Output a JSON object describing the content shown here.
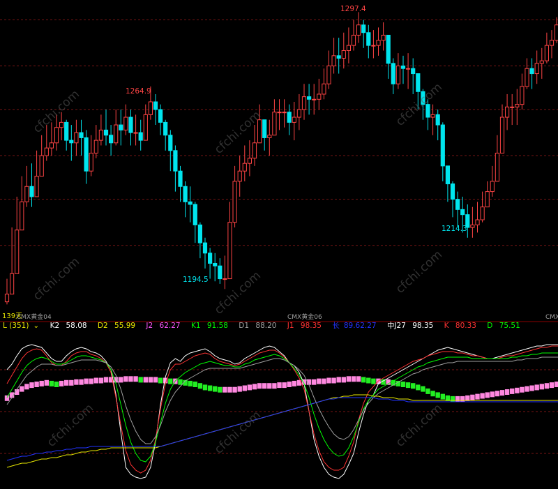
{
  "watermark": "cfchi.com",
  "colors": {
    "background": "#000000",
    "up_candle": "#ff4444",
    "down_candle": "#00e5ee",
    "grid_dash": "#7a1515",
    "frame": "#8b0000",
    "high_label": "#ff4444",
    "low_label": "#00e5ee"
  },
  "chart_data": [
    {
      "type": "candlestick",
      "title": "",
      "price_range": [
        1185,
        1302
      ],
      "annotations": {
        "peak_left": "1264.9",
        "peak_right": "1297.4",
        "trough_mid": "1194.5",
        "trough_right": "1214.3",
        "left_price_tag": "139天"
      },
      "x_labels": [
        "CMX黄金04",
        "CMX黄金06",
        "CMX"
      ],
      "close": [
        1190,
        1198,
        1215,
        1226,
        1232,
        1228,
        1236,
        1244,
        1247,
        1249,
        1255,
        1257,
        1250,
        1249,
        1253,
        1251,
        1238,
        1245,
        1250,
        1254,
        1252,
        1249,
        1256,
        1254,
        1259,
        1253,
        1253,
        1250,
        1260,
        1265,
        1262,
        1257,
        1252,
        1246,
        1238,
        1232,
        1226,
        1225,
        1217,
        1210,
        1206,
        1202,
        1201,
        1196,
        1196,
        1218,
        1234,
        1238,
        1241,
        1243,
        1249,
        1258,
        1251,
        1252,
        1261,
        1261,
        1261,
        1257,
        1259,
        1262,
        1267,
        1266,
        1266,
        1268,
        1272,
        1279,
        1283,
        1282,
        1285,
        1287,
        1291,
        1295,
        1292,
        1287,
        1287,
        1289,
        1291,
        1280,
        1272,
        1279,
        1278,
        1278,
        1276,
        1269,
        1264,
        1259,
        1260,
        1256,
        1240,
        1233,
        1227,
        1223,
        1221,
        1216,
        1217,
        1219,
        1224,
        1230,
        1234,
        1245,
        1259,
        1263,
        1263,
        1264,
        1271,
        1278,
        1276,
        1280,
        1281,
        1287,
        1289,
        1295,
        1287
      ],
      "low": [
        1186,
        1190,
        1201,
        1215,
        1224,
        1224,
        1228,
        1236,
        1242,
        1244,
        1246,
        1250,
        1246,
        1242,
        1244,
        1244,
        1233,
        1236,
        1243,
        1248,
        1248,
        1244,
        1248,
        1248,
        1252,
        1248,
        1248,
        1246,
        1252,
        1258,
        1256,
        1252,
        1246,
        1238,
        1230,
        1226,
        1220,
        1218,
        1210,
        1204,
        1200,
        1196,
        1195,
        1194,
        1192,
        1198,
        1216,
        1228,
        1234,
        1236,
        1240,
        1250,
        1246,
        1244,
        1252,
        1254,
        1255,
        1252,
        1250,
        1254,
        1258,
        1260,
        1260,
        1262,
        1266,
        1270,
        1276,
        1276,
        1278,
        1280,
        1285,
        1288,
        1286,
        1282,
        1282,
        1283,
        1285,
        1274,
        1268,
        1270,
        1272,
        1270,
        1268,
        1262,
        1258,
        1254,
        1252,
        1250,
        1234,
        1226,
        1220,
        1216,
        1214,
        1212,
        1212,
        1214,
        1218,
        1224,
        1228,
        1234,
        1248,
        1254,
        1256,
        1256,
        1262,
        1270,
        1270,
        1272,
        1274,
        1280,
        1282,
        1288,
        1282
      ],
      "high": [
        1196,
        1216,
        1228,
        1236,
        1240,
        1241,
        1246,
        1252,
        1256,
        1257,
        1260,
        1261,
        1258,
        1256,
        1258,
        1258,
        1254,
        1252,
        1256,
        1260,
        1262,
        1256,
        1262,
        1262,
        1264,
        1262,
        1260,
        1258,
        1264,
        1271,
        1268,
        1264,
        1258,
        1254,
        1248,
        1240,
        1234,
        1232,
        1226,
        1218,
        1212,
        1208,
        1206,
        1204,
        1205,
        1226,
        1240,
        1244,
        1248,
        1250,
        1256,
        1264,
        1258,
        1258,
        1266,
        1266,
        1266,
        1264,
        1265,
        1268,
        1272,
        1272,
        1272,
        1274,
        1278,
        1285,
        1290,
        1290,
        1292,
        1294,
        1297,
        1300,
        1297,
        1295,
        1293,
        1294,
        1296,
        1288,
        1282,
        1284,
        1283,
        1284,
        1282,
        1276,
        1270,
        1266,
        1264,
        1262,
        1257,
        1240,
        1234,
        1230,
        1228,
        1225,
        1224,
        1226,
        1230,
        1234,
        1240,
        1252,
        1264,
        1268,
        1268,
        1270,
        1276,
        1282,
        1282,
        1285,
        1286,
        1292,
        1293,
        1298,
        1295
      ]
    },
    {
      "type": "line",
      "title": "",
      "indicator": "L",
      "legend": [
        {
          "label": "L (351)",
          "value": "",
          "color": "#e8e800"
        },
        {
          "label": "K2",
          "value": "58.08",
          "color": "#ffffff"
        },
        {
          "label": "D2",
          "value": "55.99",
          "color": "#e8e800"
        },
        {
          "label": "J2",
          "value": "62.27",
          "color": "#ff55ff"
        },
        {
          "label": "K1",
          "value": "91.58",
          "color": "#00ff00"
        },
        {
          "label": "D1",
          "value": "88.20",
          "color": "#a0a0a0"
        },
        {
          "label": "J1",
          "value": "98.35",
          "color": "#ff3333"
        },
        {
          "label": "长",
          "value": "89.62.27",
          "color": "#2233ff"
        },
        {
          "label": "中J27",
          "value": "98.35",
          "color": "#ffffff"
        },
        {
          "label": "K",
          "value": "80.33",
          "color": "#ff3333"
        },
        {
          "label": "D",
          "value": "75.51",
          "color": "#00ff00"
        }
      ],
      "y_range": [
        0,
        100
      ],
      "histogram": [
        72,
        76,
        80,
        84,
        87,
        89,
        90,
        91,
        92,
        91,
        90,
        91,
        92,
        92,
        93,
        93,
        94,
        94,
        95,
        95,
        96,
        96,
        96,
        96,
        97,
        97,
        97,
        96,
        96,
        96,
        96,
        95,
        95,
        94,
        94,
        93,
        92,
        91,
        90,
        88,
        86,
        85,
        84,
        83,
        83,
        83,
        83,
        84,
        85,
        86,
        87,
        88,
        88,
        88,
        88,
        89,
        89,
        90,
        91,
        92,
        93,
        93,
        93,
        94,
        94,
        95,
        95,
        96,
        96,
        97,
        97,
        97,
        96,
        95,
        94,
        94,
        93,
        93,
        92,
        91,
        90,
        89,
        88,
        86,
        84,
        81,
        78,
        76,
        74,
        72,
        71,
        71,
        71,
        72,
        73,
        74,
        75,
        76,
        77,
        78,
        79,
        80,
        81,
        82,
        83,
        84,
        85,
        86,
        87,
        88,
        89,
        90,
        91
      ],
      "series": [
        {
          "name": "",
          "color": "#ffffff",
          "values": [
            80,
            84,
            90,
            95,
            97,
            98,
            97,
            96,
            92,
            88,
            86,
            86,
            90,
            93,
            95,
            96,
            95,
            93,
            92,
            90,
            86,
            80,
            62,
            35,
            10,
            5,
            3,
            2,
            3,
            10,
            28,
            55,
            75,
            85,
            88,
            86,
            90,
            92,
            93,
            94,
            95,
            93,
            90,
            88,
            87,
            86,
            84,
            85,
            88,
            90,
            92,
            94,
            96,
            97,
            96,
            93,
            90,
            85,
            83,
            78,
            70,
            50,
            30,
            18,
            10,
            5,
            3,
            2,
            5,
            12,
            20,
            35,
            48,
            58,
            62,
            70,
            72,
            74,
            76,
            78,
            80,
            82,
            84,
            86,
            88,
            90,
            92,
            94,
            95,
            96,
            95,
            94,
            93,
            92,
            91,
            90,
            89,
            88,
            88,
            89,
            90,
            91,
            92,
            93,
            94,
            95,
            96,
            97,
            97,
            98,
            98,
            98,
            98
          ]
        },
        {
          "name": "",
          "color": "#ff3333",
          "values": [
            70,
            76,
            82,
            88,
            92,
            94,
            95,
            94,
            90,
            85,
            83,
            83,
            86,
            90,
            92,
            93,
            93,
            91,
            90,
            88,
            85,
            78,
            60,
            40,
            22,
            12,
            8,
            6,
            8,
            15,
            30,
            52,
            70,
            80,
            84,
            84,
            86,
            88,
            90,
            91,
            92,
            91,
            88,
            86,
            85,
            84,
            83,
            84,
            86,
            88,
            90,
            92,
            93,
            94,
            94,
            92,
            89,
            85,
            80,
            74,
            66,
            50,
            34,
            22,
            14,
            10,
            8,
            8,
            10,
            18,
            28,
            44,
            56,
            64,
            68,
            72,
            74,
            76,
            78,
            80,
            82,
            84,
            86,
            87,
            88,
            90,
            91,
            92,
            93,
            93,
            93,
            92,
            92,
            91,
            90,
            90,
            89,
            88,
            88,
            88,
            89,
            90,
            90,
            91,
            92,
            93,
            94,
            95,
            96,
            96,
            97,
            97,
            97
          ]
        },
        {
          "name": "",
          "color": "#00ff00",
          "values": [
            60,
            66,
            72,
            78,
            83,
            86,
            88,
            89,
            88,
            86,
            84,
            84,
            85,
            87,
            89,
            90,
            90,
            89,
            88,
            87,
            85,
            80,
            70,
            55,
            40,
            28,
            20,
            15,
            14,
            18,
            28,
            42,
            56,
            66,
            72,
            75,
            78,
            80,
            82,
            84,
            85,
            86,
            85,
            84,
            83,
            83,
            82,
            82,
            84,
            85,
            87,
            88,
            89,
            90,
            91,
            90,
            88,
            85,
            81,
            76,
            70,
            60,
            48,
            38,
            30,
            24,
            20,
            18,
            19,
            24,
            32,
            42,
            52,
            58,
            62,
            66,
            68,
            70,
            72,
            74,
            76,
            78,
            80,
            82,
            83,
            85,
            86,
            87,
            88,
            89,
            89,
            89,
            89,
            89,
            88,
            88,
            88,
            88,
            88,
            88,
            88,
            88,
            89,
            89,
            90,
            90,
            91,
            91,
            92,
            92,
            92,
            92,
            92
          ]
        },
        {
          "name": "",
          "color": "#a0a0a0",
          "values": [
            55,
            60,
            66,
            71,
            76,
            79,
            82,
            84,
            84,
            84,
            83,
            83,
            84,
            85,
            86,
            87,
            87,
            87,
            87,
            86,
            85,
            82,
            76,
            66,
            54,
            44,
            36,
            30,
            27,
            27,
            32,
            40,
            50,
            58,
            64,
            68,
            72,
            74,
            76,
            78,
            80,
            81,
            81,
            81,
            81,
            81,
            81,
            81,
            82,
            83,
            84,
            85,
            86,
            87,
            88,
            88,
            87,
            85,
            83,
            80,
            76,
            69,
            60,
            52,
            45,
            39,
            34,
            31,
            30,
            32,
            37,
            44,
            51,
            56,
            60,
            63,
            65,
            67,
            69,
            71,
            73,
            75,
            77,
            78,
            80,
            81,
            82,
            83,
            84,
            85,
            85,
            86,
            86,
            86,
            86,
            86,
            86,
            86,
            86,
            86,
            86,
            86,
            86,
            87,
            87,
            88,
            88,
            88,
            89,
            89,
            89,
            89,
            89
          ]
        },
        {
          "name": "",
          "color": "#e8e800",
          "values": [
            10,
            11,
            12,
            13,
            13,
            14,
            15,
            16,
            16,
            17,
            17,
            18,
            19,
            19,
            20,
            21,
            21,
            22,
            22,
            23,
            23,
            24,
            24,
            24,
            24,
            24,
            24,
            24,
            24,
            24,
            24,
            25,
            26,
            27,
            28,
            29,
            30,
            31,
            32,
            33,
            34,
            35,
            36,
            37,
            38,
            39,
            40,
            41,
            42,
            43,
            44,
            45,
            46,
            47,
            48,
            49,
            50,
            51,
            52,
            53,
            54,
            55,
            56,
            57,
            58,
            59,
            60,
            60,
            61,
            61,
            62,
            62,
            62,
            62,
            61,
            61,
            60,
            60,
            60,
            59,
            59,
            59,
            58,
            58,
            58,
            58,
            58,
            58,
            58,
            58,
            58,
            58,
            58,
            58,
            58,
            58,
            58,
            58,
            58,
            58,
            58,
            58,
            58,
            58,
            58,
            58,
            58,
            58,
            58,
            58,
            58,
            58,
            58
          ]
        },
        {
          "name": "",
          "color": "#2233ff",
          "values": [
            15,
            16,
            17,
            18,
            18,
            19,
            20,
            20,
            21,
            21,
            22,
            22,
            23,
            23,
            24,
            24,
            24,
            25,
            25,
            25,
            25,
            25,
            25,
            25,
            25,
            25,
            25,
            25,
            25,
            25,
            25,
            25,
            26,
            27,
            28,
            29,
            30,
            31,
            32,
            33,
            34,
            35,
            36,
            37,
            38,
            39,
            40,
            41,
            42,
            43,
            44,
            45,
            46,
            47,
            48,
            49,
            50,
            51,
            52,
            53,
            54,
            55,
            56,
            57,
            58,
            59,
            59,
            60,
            60,
            60,
            60,
            60,
            60,
            60,
            60,
            59,
            59,
            59,
            58,
            58,
            58,
            57,
            57,
            57,
            57,
            57,
            57,
            57,
            57,
            57,
            57,
            57,
            57,
            57,
            57,
            57,
            57,
            57,
            57,
            57,
            57,
            57,
            57,
            57,
            57,
            57,
            57,
            57,
            57,
            57,
            57,
            57,
            57
          ]
        }
      ]
    }
  ]
}
